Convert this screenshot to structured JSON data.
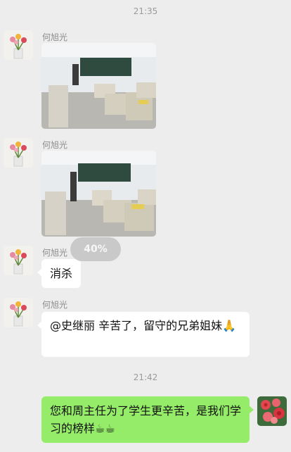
{
  "timestamps": {
    "top": "21:35",
    "second": "21:42"
  },
  "messages": [
    {
      "sender": "何旭光",
      "type": "image",
      "caption": "classroom-photo"
    },
    {
      "sender": "何旭光",
      "type": "image",
      "caption": "classroom-photo"
    },
    {
      "sender": "何旭光",
      "type": "text",
      "text": "消杀"
    },
    {
      "sender": "何旭光",
      "type": "text",
      "text": "@史继丽  辛苦了，留守的兄弟姐妹🙏"
    },
    {
      "sender": "self",
      "type": "text",
      "text": "您和周主任为了学生更辛苦，是我们学习的榜样☕☕"
    }
  ],
  "upload": {
    "progress_label": "40%",
    "progress": 0.4
  },
  "colors": {
    "background": "#ededed",
    "self_bubble": "#95ec69",
    "other_bubble": "#ffffff"
  }
}
